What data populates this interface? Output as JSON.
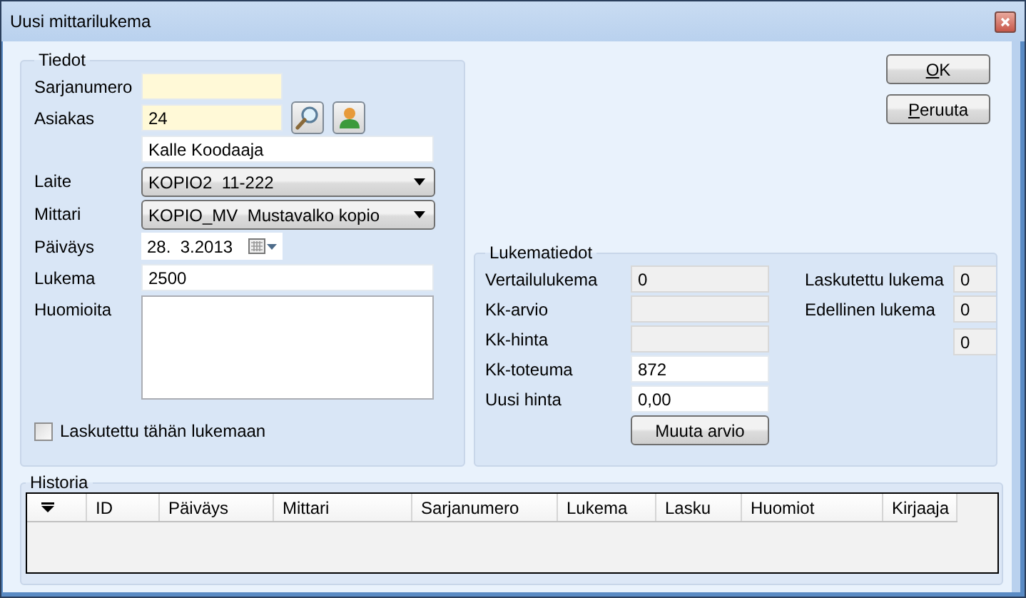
{
  "window": {
    "title": "Uusi mittarilukema"
  },
  "buttons": [
    {
      "label": "OK",
      "first_letter_underlined": true
    },
    {
      "label": "Peruuta",
      "first_letter_underlined": true
    }
  ],
  "tiedot": {
    "title": "Tiedot",
    "rows": [
      {
        "kind": "input",
        "label": "Sarjanumero",
        "required": true
      },
      {
        "kind": "lookup",
        "label": "Asiakas",
        "value": "24",
        "required": true
      },
      {
        "kind": "input",
        "value": "Kalle Koodaaja",
        "required": false
      },
      {
        "kind": "combo",
        "label": "Laite",
        "value": "KOPIO2  11-222"
      },
      {
        "kind": "combo",
        "label": "Mittari",
        "value": "KOPIO_MV  Mustavalko kopio"
      },
      {
        "kind": "date",
        "label": "Päiväys",
        "value": "28.  3.2013"
      },
      {
        "kind": "input",
        "label": "Lukema",
        "value": "2500",
        "required": false
      },
      {
        "kind": "memo",
        "label": "Huomioita"
      }
    ],
    "checkbox": {
      "label": "Laskutettu tähän lukemaan",
      "checked": false
    }
  },
  "lukematiedot": {
    "title": "Lukematiedot",
    "left": [
      {
        "label": "Vertailulukema",
        "value": "0",
        "readonly": true
      },
      {
        "label": "Kk-arvio",
        "readonly": true
      },
      {
        "label": "Kk-hinta",
        "readonly": true
      },
      {
        "label": "Kk-toteuma",
        "value": "872",
        "readonly": false
      },
      {
        "label": "Uusi hinta",
        "value": "0,00",
        "readonly": false
      }
    ],
    "button": "Muuta arvio",
    "right": [
      {
        "label": "Laskutettu lukema",
        "value": "0"
      },
      {
        "label": "Edellinen lukema",
        "value": "0"
      },
      {
        "value": "0"
      }
    ]
  },
  "historia": {
    "title": "Historia",
    "columns": [
      "ID",
      "Päiväys",
      "Mittari",
      "Sarjanumero",
      "Lukema",
      "Lasku",
      "Huomiot",
      "Kirjaaja"
    ]
  }
}
